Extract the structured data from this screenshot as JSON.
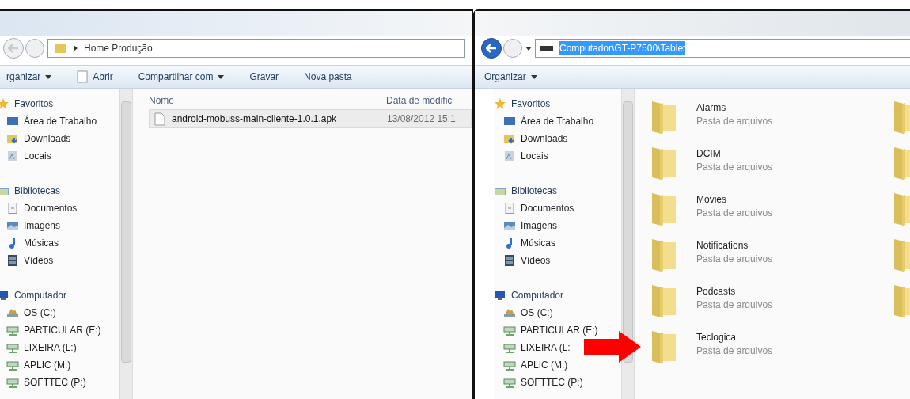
{
  "windows": [
    {
      "address": {
        "crumbs": [
          "Home Produção"
        ],
        "selected": false
      },
      "toolbar": [
        {
          "label": "rganizar",
          "kind": "menu"
        },
        {
          "label": "Abrir",
          "kind": "open"
        },
        {
          "label": "Compartilhar com",
          "kind": "menu"
        },
        {
          "label": "Gravar",
          "kind": "plain"
        },
        {
          "label": "Nova pasta",
          "kind": "plain"
        }
      ],
      "sidebar": [
        {
          "label": "Favoritos",
          "children": [
            {
              "label": "Área de Trabalho"
            },
            {
              "label": "Downloads"
            },
            {
              "label": "Locais"
            }
          ]
        },
        {
          "label": "Bibliotecas",
          "children": [
            {
              "label": "Documentos"
            },
            {
              "label": "Imagens"
            },
            {
              "label": "Músicas"
            },
            {
              "label": "Vídeos"
            }
          ]
        },
        {
          "label": "Computador",
          "children": [
            {
              "label": "OS (C:)"
            },
            {
              "label": "PARTICULAR (E:)"
            },
            {
              "label": "LIXEIRA (L:)"
            },
            {
              "label": "APLIC (M:)"
            },
            {
              "label": "SOFTTEC (P:)"
            }
          ]
        }
      ],
      "columns": [
        "Nome",
        "Data de modific"
      ],
      "files": [
        {
          "name": "android-mobuss-main-cliente-1.0.1.apk",
          "date": "13/08/2012 15:1",
          "selected": true
        }
      ]
    },
    {
      "address": {
        "text": "Computador\\GT-P7500\\Tablet",
        "selected": true
      },
      "toolbar": [
        {
          "label": "Organizar",
          "kind": "menu"
        }
      ],
      "sidebar": [
        {
          "label": "Favoritos",
          "children": [
            {
              "label": "Área de Trabalho"
            },
            {
              "label": "Downloads"
            },
            {
              "label": "Locais"
            }
          ]
        },
        {
          "label": "Bibliotecas",
          "children": [
            {
              "label": "Documentos"
            },
            {
              "label": "Imagens"
            },
            {
              "label": "Músicas"
            },
            {
              "label": "Vídeos"
            }
          ]
        },
        {
          "label": "Computador",
          "children": [
            {
              "label": "OS (C:)"
            },
            {
              "label": "PARTICULAR (E:)"
            },
            {
              "label": "LIXEIRA (L:"
            },
            {
              "label": "APLIC (M:)"
            },
            {
              "label": "SOFTTEC (P:)"
            }
          ]
        }
      ],
      "folders": [
        {
          "name": "Alarms",
          "type": "Pasta de arquivos"
        },
        {
          "name": "DCIM",
          "type": "Pasta de arquivos"
        },
        {
          "name": "Movies",
          "type": "Pasta de arquivos"
        },
        {
          "name": "Notifications",
          "type": "Pasta de arquivos"
        },
        {
          "name": "Podcasts",
          "type": "Pasta de arquivos"
        },
        {
          "name": "Teclogica",
          "type": "Pasta de arquivos"
        }
      ]
    }
  ]
}
